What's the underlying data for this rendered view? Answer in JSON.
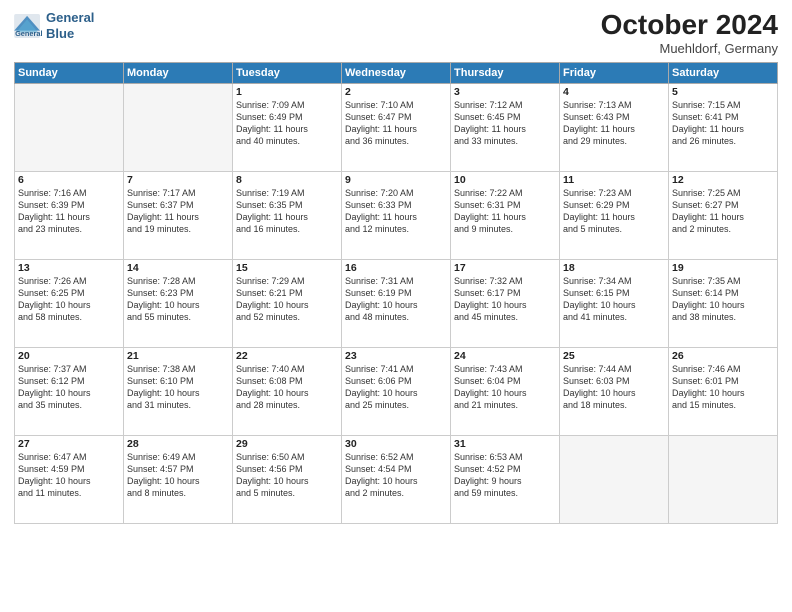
{
  "header": {
    "logo_line1": "General",
    "logo_line2": "Blue",
    "month": "October 2024",
    "location": "Muehldorf, Germany"
  },
  "weekdays": [
    "Sunday",
    "Monday",
    "Tuesday",
    "Wednesday",
    "Thursday",
    "Friday",
    "Saturday"
  ],
  "weeks": [
    [
      {
        "day": "",
        "info": ""
      },
      {
        "day": "",
        "info": ""
      },
      {
        "day": "1",
        "info": "Sunrise: 7:09 AM\nSunset: 6:49 PM\nDaylight: 11 hours\nand 40 minutes."
      },
      {
        "day": "2",
        "info": "Sunrise: 7:10 AM\nSunset: 6:47 PM\nDaylight: 11 hours\nand 36 minutes."
      },
      {
        "day": "3",
        "info": "Sunrise: 7:12 AM\nSunset: 6:45 PM\nDaylight: 11 hours\nand 33 minutes."
      },
      {
        "day": "4",
        "info": "Sunrise: 7:13 AM\nSunset: 6:43 PM\nDaylight: 11 hours\nand 29 minutes."
      },
      {
        "day": "5",
        "info": "Sunrise: 7:15 AM\nSunset: 6:41 PM\nDaylight: 11 hours\nand 26 minutes."
      }
    ],
    [
      {
        "day": "6",
        "info": "Sunrise: 7:16 AM\nSunset: 6:39 PM\nDaylight: 11 hours\nand 23 minutes."
      },
      {
        "day": "7",
        "info": "Sunrise: 7:17 AM\nSunset: 6:37 PM\nDaylight: 11 hours\nand 19 minutes."
      },
      {
        "day": "8",
        "info": "Sunrise: 7:19 AM\nSunset: 6:35 PM\nDaylight: 11 hours\nand 16 minutes."
      },
      {
        "day": "9",
        "info": "Sunrise: 7:20 AM\nSunset: 6:33 PM\nDaylight: 11 hours\nand 12 minutes."
      },
      {
        "day": "10",
        "info": "Sunrise: 7:22 AM\nSunset: 6:31 PM\nDaylight: 11 hours\nand 9 minutes."
      },
      {
        "day": "11",
        "info": "Sunrise: 7:23 AM\nSunset: 6:29 PM\nDaylight: 11 hours\nand 5 minutes."
      },
      {
        "day": "12",
        "info": "Sunrise: 7:25 AM\nSunset: 6:27 PM\nDaylight: 11 hours\nand 2 minutes."
      }
    ],
    [
      {
        "day": "13",
        "info": "Sunrise: 7:26 AM\nSunset: 6:25 PM\nDaylight: 10 hours\nand 58 minutes."
      },
      {
        "day": "14",
        "info": "Sunrise: 7:28 AM\nSunset: 6:23 PM\nDaylight: 10 hours\nand 55 minutes."
      },
      {
        "day": "15",
        "info": "Sunrise: 7:29 AM\nSunset: 6:21 PM\nDaylight: 10 hours\nand 52 minutes."
      },
      {
        "day": "16",
        "info": "Sunrise: 7:31 AM\nSunset: 6:19 PM\nDaylight: 10 hours\nand 48 minutes."
      },
      {
        "day": "17",
        "info": "Sunrise: 7:32 AM\nSunset: 6:17 PM\nDaylight: 10 hours\nand 45 minutes."
      },
      {
        "day": "18",
        "info": "Sunrise: 7:34 AM\nSunset: 6:15 PM\nDaylight: 10 hours\nand 41 minutes."
      },
      {
        "day": "19",
        "info": "Sunrise: 7:35 AM\nSunset: 6:14 PM\nDaylight: 10 hours\nand 38 minutes."
      }
    ],
    [
      {
        "day": "20",
        "info": "Sunrise: 7:37 AM\nSunset: 6:12 PM\nDaylight: 10 hours\nand 35 minutes."
      },
      {
        "day": "21",
        "info": "Sunrise: 7:38 AM\nSunset: 6:10 PM\nDaylight: 10 hours\nand 31 minutes."
      },
      {
        "day": "22",
        "info": "Sunrise: 7:40 AM\nSunset: 6:08 PM\nDaylight: 10 hours\nand 28 minutes."
      },
      {
        "day": "23",
        "info": "Sunrise: 7:41 AM\nSunset: 6:06 PM\nDaylight: 10 hours\nand 25 minutes."
      },
      {
        "day": "24",
        "info": "Sunrise: 7:43 AM\nSunset: 6:04 PM\nDaylight: 10 hours\nand 21 minutes."
      },
      {
        "day": "25",
        "info": "Sunrise: 7:44 AM\nSunset: 6:03 PM\nDaylight: 10 hours\nand 18 minutes."
      },
      {
        "day": "26",
        "info": "Sunrise: 7:46 AM\nSunset: 6:01 PM\nDaylight: 10 hours\nand 15 minutes."
      }
    ],
    [
      {
        "day": "27",
        "info": "Sunrise: 6:47 AM\nSunset: 4:59 PM\nDaylight: 10 hours\nand 11 minutes."
      },
      {
        "day": "28",
        "info": "Sunrise: 6:49 AM\nSunset: 4:57 PM\nDaylight: 10 hours\nand 8 minutes."
      },
      {
        "day": "29",
        "info": "Sunrise: 6:50 AM\nSunset: 4:56 PM\nDaylight: 10 hours\nand 5 minutes."
      },
      {
        "day": "30",
        "info": "Sunrise: 6:52 AM\nSunset: 4:54 PM\nDaylight: 10 hours\nand 2 minutes."
      },
      {
        "day": "31",
        "info": "Sunrise: 6:53 AM\nSunset: 4:52 PM\nDaylight: 9 hours\nand 59 minutes."
      },
      {
        "day": "",
        "info": ""
      },
      {
        "day": "",
        "info": ""
      }
    ]
  ]
}
